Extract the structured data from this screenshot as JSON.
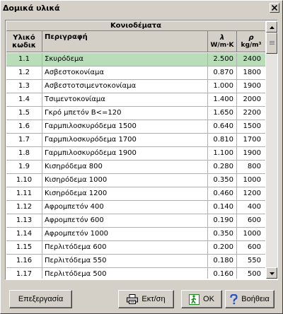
{
  "window": {
    "title": "Δομικά υλικά"
  },
  "table": {
    "group_title": "Κονιοδέματα",
    "headers": {
      "code": "Υλικό κωδικ",
      "description": "Περιγραφή",
      "lambda_symbol": "λ",
      "lambda_unit": "W/m·K",
      "rho_symbol": "ρ",
      "rho_unit": "kg/m³"
    },
    "rows": [
      {
        "code": "1.1",
        "desc": "Σκυρόδεμα",
        "lambda": "2.500",
        "rho": "2400",
        "selected": true
      },
      {
        "code": "1.2",
        "desc": "Ασβεστοκονίαμα",
        "lambda": "0.870",
        "rho": "1800"
      },
      {
        "code": "1.3",
        "desc": "Ασβεστοτσιμεντοκονίαμα",
        "lambda": "1.000",
        "rho": "1900"
      },
      {
        "code": "1.4",
        "desc": "Τσιμεντοκονίαμα",
        "lambda": "1.400",
        "rho": "2000"
      },
      {
        "code": "1.5",
        "desc": "Γκρό μπετόν B<=120",
        "lambda": "1.650",
        "rho": "2200"
      },
      {
        "code": "1.6",
        "desc": "Γαρμπιλοσκυρόδεμα  1500",
        "lambda": "0.640",
        "rho": "1500"
      },
      {
        "code": "1.7",
        "desc": "Γαρμπιλοσκυρόδεμα  1700",
        "lambda": "0.810",
        "rho": "1700"
      },
      {
        "code": "1.8",
        "desc": "Γαρμπιλοσκυρόδεμα  1900",
        "lambda": "1.100",
        "rho": "1900"
      },
      {
        "code": "1.9",
        "desc": "Κισηρόδεμα 800",
        "lambda": "0.280",
        "rho": "800"
      },
      {
        "code": "1.10",
        "desc": "Κισηρόδεμα 1000",
        "lambda": "0.350",
        "rho": "1000"
      },
      {
        "code": "1.11",
        "desc": "Κισηρόδεμα 1200",
        "lambda": "0.460",
        "rho": "1200"
      },
      {
        "code": "1.12",
        "desc": "Αφρομπετόν 400",
        "lambda": "0.140",
        "rho": "400"
      },
      {
        "code": "1.13",
        "desc": "Αφρομπετόν 600",
        "lambda": "0.190",
        "rho": "600"
      },
      {
        "code": "1.14",
        "desc": "Αφρομπετόν 1000",
        "lambda": "0.350",
        "rho": "1000"
      },
      {
        "code": "1.15",
        "desc": "Περλιτόδεμα 600",
        "lambda": "0.200",
        "rho": "600"
      },
      {
        "code": "1.16",
        "desc": "Περλιτόδεμα 550",
        "lambda": "0.180",
        "rho": "550"
      },
      {
        "code": "1.17",
        "desc": "Περλιτόδεμα 500",
        "lambda": "0.160",
        "rho": "500"
      }
    ]
  },
  "buttons": {
    "edit": "Επεξεργασία",
    "print": "Εκτ/ση",
    "ok": "OK",
    "help": "Βοήθεια"
  },
  "icons": {
    "close": "close-icon",
    "print": "printer-icon",
    "ok": "exit-door-icon",
    "help": "question-icon",
    "scroll_up": "arrow-up-icon",
    "scroll_down": "arrow-down-icon"
  },
  "colors": {
    "selected_row": "#b9dcb9",
    "face": "#d4d0c8",
    "help_icon": "#1f4fd1",
    "ok_icon": "#1a8a1a"
  }
}
